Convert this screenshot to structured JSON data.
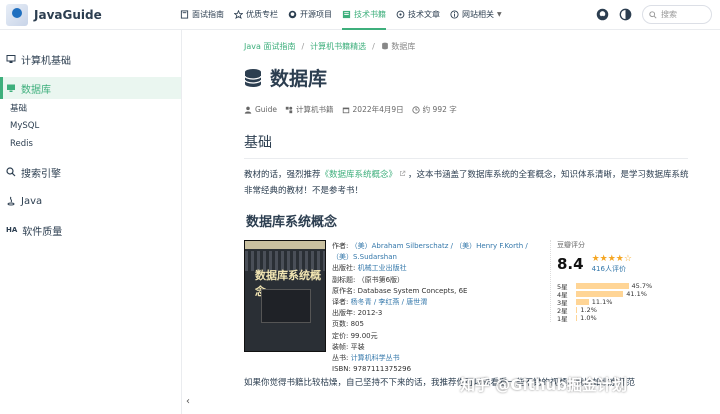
{
  "brand": {
    "title": "JavaGuide"
  },
  "nav": {
    "items": [
      {
        "label": "面试指南",
        "icon": "book-icon"
      },
      {
        "label": "优质专栏",
        "icon": "star-icon"
      },
      {
        "label": "开源项目",
        "icon": "github-icon"
      },
      {
        "label": "技术书籍",
        "icon": "book-open-icon",
        "active": true
      },
      {
        "label": "技术文章",
        "icon": "article-icon"
      },
      {
        "label": "网站相关",
        "icon": "info-icon",
        "dropdown": true
      }
    ],
    "search_placeholder": "搜索"
  },
  "sidebar": {
    "groups": [
      {
        "label": "计算机基础",
        "icon": "computer-icon"
      },
      {
        "label": "数据库",
        "icon": "monitor-icon",
        "active": true
      }
    ],
    "items": [
      "基础",
      "MySQL",
      "Redis"
    ],
    "groups2": [
      {
        "label": "搜索引擎",
        "icon": "search-icon"
      },
      {
        "label": "Java",
        "icon": "java-icon"
      },
      {
        "label": "软件质量",
        "icon": "ha-icon",
        "icon_text": "HA"
      }
    ]
  },
  "breadcrumb": {
    "a": "Java 面试指南",
    "b": "计算机书籍精选",
    "c": "数据库"
  },
  "page": {
    "title": "数据库",
    "author": "Guide",
    "category": "计算机书籍",
    "date": "2022年4月9日",
    "read": "约 992 字"
  },
  "section": {
    "title": "基础"
  },
  "intro": {
    "p1": "教材的话，强烈推荐",
    "link": "《数据库系统概念》",
    "p2": "，这本书涵盖了数据库系统的全套概念，知识体系清晰，是学习数据库系统非常经典的教材！不是参考书！"
  },
  "subsection": {
    "title": "数据库系统概念"
  },
  "book": {
    "cover_title": "数据库系统概念",
    "lines": [
      {
        "k": "作者:",
        "v": "（美）Abraham Silberschatz / （美）Henry F.Korth / （美）S.Sudarshan",
        "link": true
      },
      {
        "k": "出版社:",
        "v": "机械工业出版社",
        "link": true
      },
      {
        "k": "副标题:",
        "v": "（原书第6版）"
      },
      {
        "k": "原作名:",
        "v": "Database System Concepts, 6E"
      },
      {
        "k": "译者:",
        "v": "杨冬青 / 李红燕 / 唐世渭",
        "link": true
      },
      {
        "k": "出版年:",
        "v": "2012-3"
      },
      {
        "k": "页数:",
        "v": "805"
      },
      {
        "k": "定价:",
        "v": "99.00元"
      },
      {
        "k": "装帧:",
        "v": "平装"
      },
      {
        "k": "丛书:",
        "v": "计算机科学丛书",
        "link": true
      },
      {
        "k": "ISBN:",
        "v": "9787111375296"
      }
    ]
  },
  "rating": {
    "label": "豆瓣评分",
    "score": "8.4",
    "stars": "★★★★☆",
    "count": "416人评价",
    "dist": [
      {
        "star": "5星",
        "pct": "45.7%",
        "value": 45.7
      },
      {
        "star": "4星",
        "pct": "41.1%",
        "value": 41.1
      },
      {
        "star": "3星",
        "pct": "11.1%",
        "value": 11.1
      },
      {
        "star": "2星",
        "pct": "1.2%",
        "value": 1.2
      },
      {
        "star": "1星",
        "pct": "1.0%",
        "value": 1.0
      }
    ]
  },
  "bottom": {
    "text": "如果你觉得书籍比较枯燥，自己坚持不下来的话，我推荐你可以先看看一些不错的视频，就比如北京师范"
  },
  "watermark": "知乎 @Github掘金计划"
}
